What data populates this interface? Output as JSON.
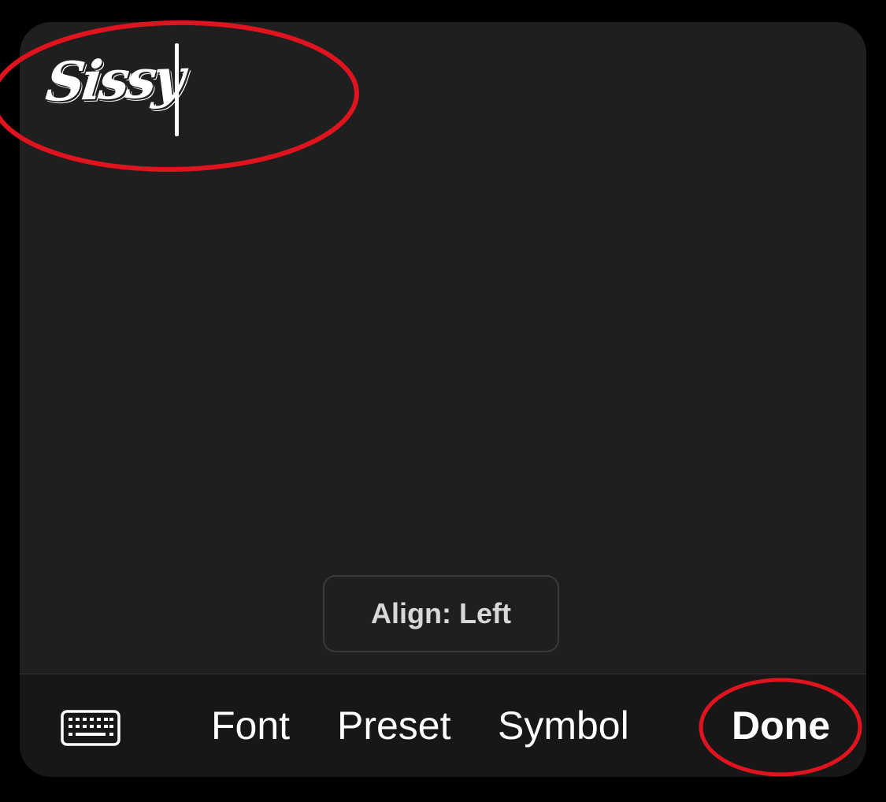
{
  "editor": {
    "typed_text": "Sissy",
    "align_label": "Align: Left"
  },
  "toolbar": {
    "keyboard_icon": "keyboard-icon",
    "font_label": "Font",
    "preset_label": "Preset",
    "symbol_label": "Symbol",
    "done_label": "Done"
  },
  "colors": {
    "panel_bg": "#1f1f1f",
    "toolbar_bg": "#171717",
    "annotation_red": "#e0141e",
    "text": "#ffffff"
  }
}
